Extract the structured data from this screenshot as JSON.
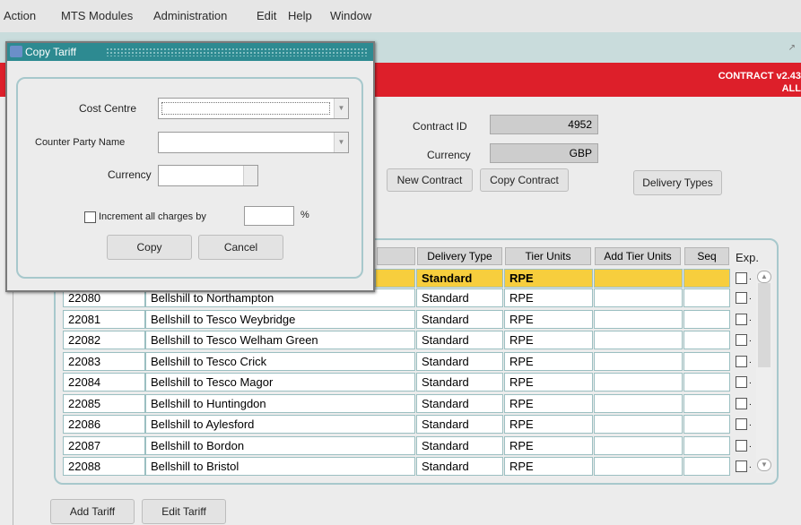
{
  "menu": [
    "Action",
    "MTS Modules",
    "Administration",
    "Edit",
    "Help",
    "Window"
  ],
  "header": {
    "title": "CONTRACT v2.43",
    "subtitle": "ALL"
  },
  "contract": {
    "id_label": "Contract ID",
    "id_value": "4952",
    "currency_label": "Currency",
    "currency_value": "GBP"
  },
  "buttons": {
    "new_contract": "New Contract",
    "copy_contract": "Copy Contract",
    "delivery_types": "Delivery Types",
    "add_tariff": "Add Tariff",
    "edit_tariff": "Edit Tariff"
  },
  "table": {
    "headers": {
      "delivery_type": "Delivery Type",
      "tier_units": "Tier Units",
      "add_tier_units": "Add Tier Units",
      "seq": "Seq",
      "exp": "Exp."
    },
    "selected_row": {
      "delivery_type": "Standard",
      "tier_units": "RPE"
    },
    "rows": [
      {
        "id": "22080",
        "name": "Bellshill to Northampton",
        "delivery_type": "Standard",
        "tier_units": "RPE"
      },
      {
        "id": "22081",
        "name": "Bellshill to Tesco Weybridge",
        "delivery_type": "Standard",
        "tier_units": "RPE"
      },
      {
        "id": "22082",
        "name": "Bellshill to Tesco Welham Green",
        "delivery_type": "Standard",
        "tier_units": "RPE"
      },
      {
        "id": "22083",
        "name": "Bellshill to Tesco Crick",
        "delivery_type": "Standard",
        "tier_units": "RPE"
      },
      {
        "id": "22084",
        "name": "Bellshill to Tesco Magor",
        "delivery_type": "Standard",
        "tier_units": "RPE"
      },
      {
        "id": "22085",
        "name": "Bellshill to Huntingdon",
        "delivery_type": "Standard",
        "tier_units": "RPE"
      },
      {
        "id": "22086",
        "name": "Bellshill to Aylesford",
        "delivery_type": "Standard",
        "tier_units": "RPE"
      },
      {
        "id": "22087",
        "name": "Bellshill to Bordon",
        "delivery_type": "Standard",
        "tier_units": "RPE"
      },
      {
        "id": "22088",
        "name": "Bellshill to Bristol",
        "delivery_type": "Standard",
        "tier_units": "RPE"
      }
    ]
  },
  "dialog": {
    "title": "Copy Tariff",
    "cost_centre_label": "Cost Centre",
    "counter_party_label": "Counter Party Name",
    "currency_label": "Currency",
    "increment_label": "Increment all charges by",
    "percent": "%",
    "copy": "Copy",
    "cancel": "Cancel"
  },
  "colors": {
    "header_red": "#dd1f2a",
    "selected_row": "#f7ce3d",
    "dialog_title": "#2d8a91"
  }
}
